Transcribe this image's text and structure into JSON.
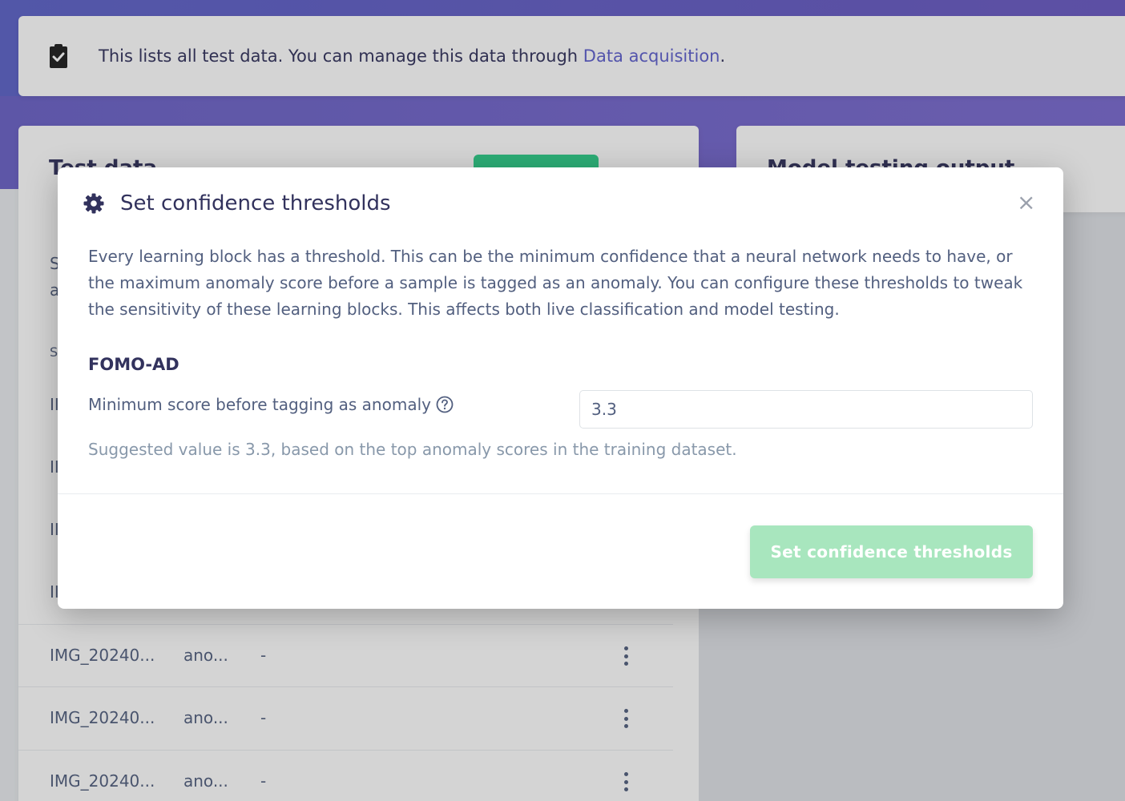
{
  "banner": {
    "text": "This lists all test data. You can manage this data through ",
    "link": "Data acquisition",
    "suffix": ".",
    "icon": "clipboard-check-icon"
  },
  "left_card": {
    "title": "Test data",
    "stub_top": [
      "S",
      "a"
    ],
    "stub_header": "S",
    "stub_rows": [
      "II",
      "II",
      "II",
      "II"
    ],
    "rows": [
      {
        "name": "IMG_20240...",
        "label": "ano...",
        "result": "-"
      },
      {
        "name": "IMG_20240...",
        "label": "ano...",
        "result": "-"
      },
      {
        "name": "IMG_20240...",
        "label": "ano...",
        "result": "-"
      }
    ]
  },
  "right_card": {
    "title": "Model testing output"
  },
  "modal": {
    "title": "Set confidence thresholds",
    "title_icon": "gear-icon",
    "close_label": "×",
    "description": "Every learning block has a threshold. This can be the minimum confidence that a neural network needs to have, or the maximum anomaly score before a sample is tagged as an anomaly. You can configure these thresholds to tweak the sensitivity of these learning blocks. This affects both live classification and model testing.",
    "block_name": "FOMO-AD",
    "field_label": "Minimum score before tagging as anomaly",
    "field_value": "3.3",
    "hint": "Suggested value is 3.3, based on the top anomaly scores in the training dataset.",
    "submit_label": "Set confidence thresholds"
  },
  "colors": {
    "accent": "#5e60ce",
    "success": "#2dce89",
    "text": "#32325d"
  }
}
